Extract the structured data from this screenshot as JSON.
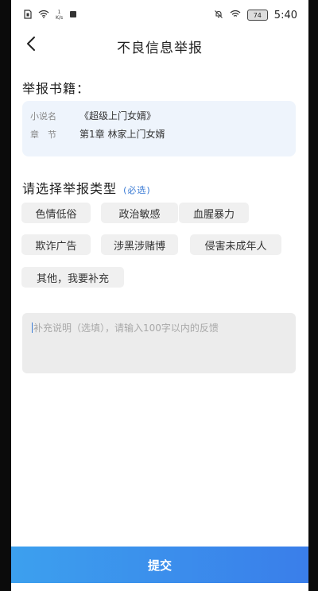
{
  "status_bar": {
    "network_speed_value": "1",
    "network_speed_unit": "K/s",
    "battery": "74",
    "time": "5:40"
  },
  "header": {
    "title": "不良信息举报"
  },
  "book_section": {
    "heading": "举报书籍：",
    "novel_label": "小说名",
    "novel_value": "《超级上门女婿》",
    "chapter_label": "章　节",
    "chapter_value": "第1章  林家上门女婿"
  },
  "type_section": {
    "heading": "请选择举报类型",
    "required_tag": "(必选)",
    "options": [
      "色情低俗",
      "政治敏感",
      "血腥暴力",
      "欺诈广告",
      "涉黑涉赌博",
      "侵害未成年人",
      "其他，我要补充"
    ]
  },
  "supplement": {
    "placeholder": "补充说明（选填），请输入100字以内的反馈"
  },
  "footer": {
    "submit_label": "提交"
  },
  "colors": {
    "accent": "#3a7eea",
    "accent_light": "#3ca0ee",
    "card_bg": "#eef4fc",
    "chip_bg": "#f0f0f0"
  },
  "icons": {
    "back": "chevron-left-icon",
    "sim": "sim-card-icon",
    "wifi": "wifi-icon",
    "notification": "square-notification-icon",
    "mute": "bell-off-icon",
    "signal": "signal-icon"
  }
}
